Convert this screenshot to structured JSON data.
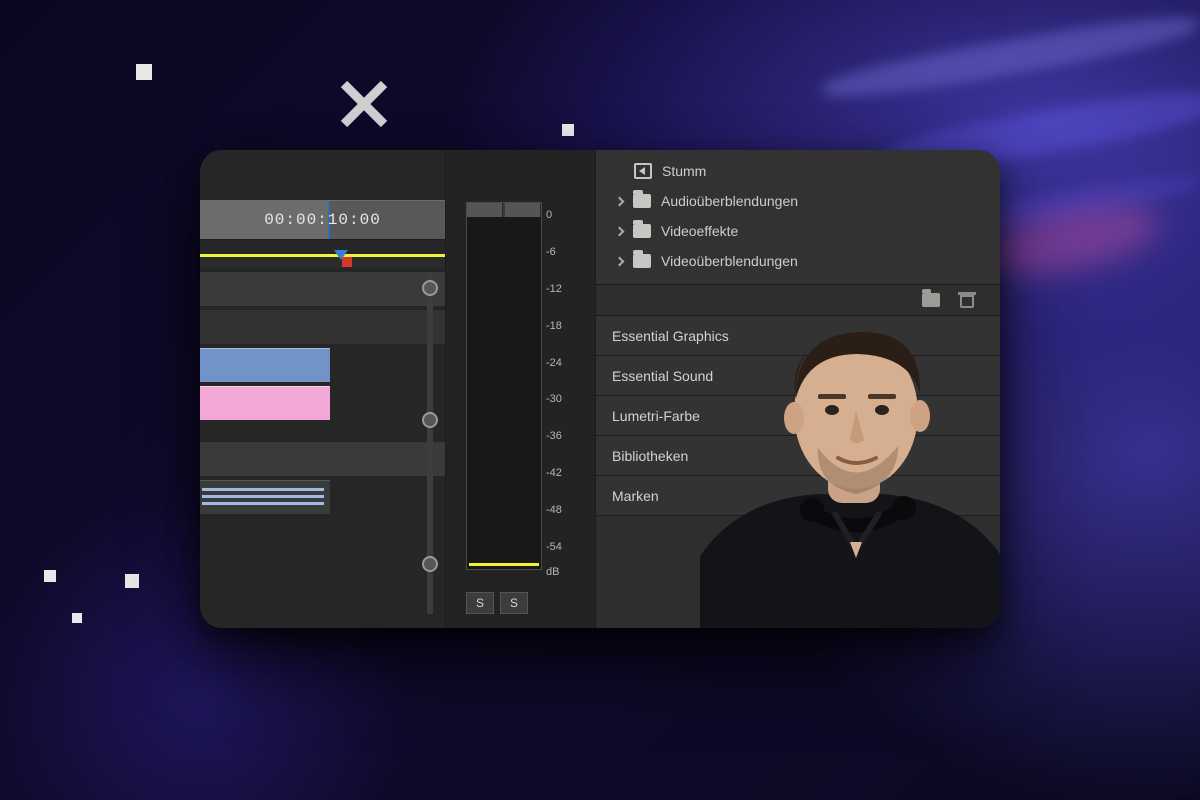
{
  "timeline": {
    "timecode": "00:00:10:00"
  },
  "meter": {
    "ticks": [
      {
        "label": "0",
        "pct": 2
      },
      {
        "label": "-6",
        "pct": 12
      },
      {
        "label": "-12",
        "pct": 22
      },
      {
        "label": "-18",
        "pct": 32
      },
      {
        "label": "-24",
        "pct": 42
      },
      {
        "label": "-30",
        "pct": 52
      },
      {
        "label": "-36",
        "pct": 62
      },
      {
        "label": "-42",
        "pct": 72
      },
      {
        "label": "-48",
        "pct": 82
      },
      {
        "label": "-54",
        "pct": 92
      },
      {
        "label": "dB",
        "pct": 99
      }
    ],
    "solo_a": "S",
    "solo_b": "S"
  },
  "effects": {
    "stumm": "Stumm",
    "items": [
      "Audioüberblendungen",
      "Videoeffekte",
      "Videoüberblendungen"
    ]
  },
  "panels": {
    "p0": "Essential Graphics",
    "p1": "Essential Sound",
    "p2": "Lumetri-Farbe",
    "p3": "Bibliotheken",
    "p4": "Marken"
  }
}
